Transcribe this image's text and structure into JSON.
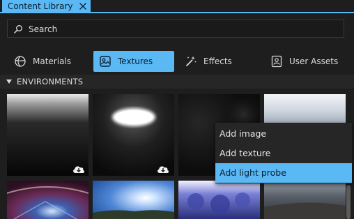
{
  "panel": {
    "tab_title": "Content Library"
  },
  "search": {
    "placeholder": "Search"
  },
  "categories": [
    {
      "label": "Materials",
      "icon": "materials-icon",
      "active": false
    },
    {
      "label": "Textures",
      "icon": "textures-icon",
      "active": true
    },
    {
      "label": "Effects",
      "icon": "effects-icon",
      "active": false
    },
    {
      "label": "User Assets",
      "icon": "user-assets-icon",
      "active": false
    }
  ],
  "section": {
    "title": "ENVIRONMENTS",
    "expanded": true
  },
  "context_menu": {
    "items": [
      {
        "label": "Add image",
        "highlighted": false
      },
      {
        "label": "Add texture",
        "highlighted": false
      },
      {
        "label": "Add light probe",
        "highlighted": true
      }
    ]
  },
  "colors": {
    "accent": "#5ab8f5",
    "background": "#1e1e1e"
  }
}
